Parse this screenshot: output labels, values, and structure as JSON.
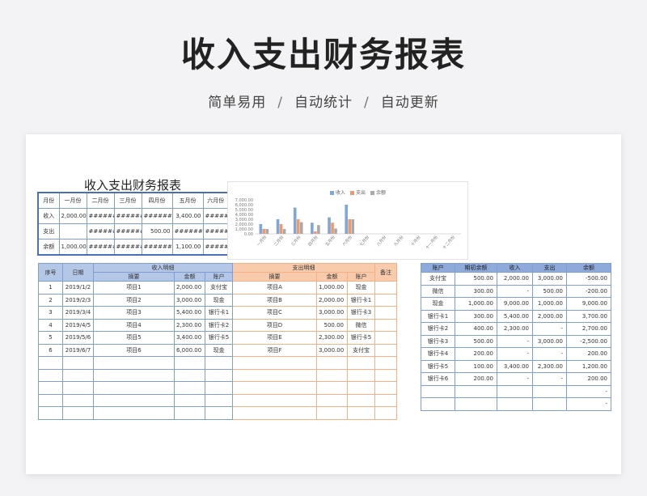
{
  "header": {
    "title": "收入支出财务报表",
    "tagline": [
      "简单易用",
      "自动统计",
      "自动更新"
    ],
    "separator": "/"
  },
  "sheet_title": "收入支出财务报表",
  "summary": {
    "months": [
      "月份",
      "一月份",
      "二月份",
      "三月份",
      "四月份",
      "五月份",
      "六月份"
    ],
    "rows": [
      {
        "label": "收入",
        "cells": [
          "2,000.00",
          "########",
          "########",
          "########",
          "3,400.00",
          "########"
        ]
      },
      {
        "label": "支出",
        "cells": [
          "",
          "########",
          "########",
          "500.00",
          "########",
          "########"
        ]
      },
      {
        "label": "余额",
        "cells": [
          "1,000.00",
          "########",
          "########",
          "########",
          "1,100.00",
          "########"
        ]
      }
    ]
  },
  "chart_data": {
    "type": "bar",
    "categories": [
      "一月份",
      "二月份",
      "三月份",
      "四月份",
      "五月份",
      "六月份",
      "七月份",
      "八月份",
      "九月份",
      "十月份",
      "十一月份",
      "十二月份"
    ],
    "series": [
      {
        "name": "收入",
        "values": [
          2000,
          3000,
          5400,
          2300,
          3400,
          6000,
          0,
          0,
          0,
          0,
          0,
          0
        ]
      },
      {
        "name": "支出",
        "values": [
          1000,
          2000,
          3000,
          500,
          2300,
          3000,
          0,
          0,
          0,
          0,
          0,
          0
        ]
      },
      {
        "name": "余额",
        "values": [
          1000,
          1000,
          2400,
          1800,
          1100,
          3000,
          0,
          0,
          0,
          0,
          0,
          0
        ]
      }
    ],
    "y_ticks": [
      "7,000.00",
      "6,000.00",
      "5,000.00",
      "4,000.00",
      "3,000.00",
      "2,000.00",
      "1,000.00",
      "0.00"
    ],
    "ylim": [
      0,
      7000
    ],
    "colors": [
      "#7ea6d8",
      "#ee9a6c",
      "#a9a9a9"
    ],
    "legend_position": "top"
  },
  "ledger": {
    "group_headers": {
      "index": "序号",
      "date": "日期",
      "income": "收入明细",
      "expense": "支出明细",
      "note": "备注"
    },
    "sub_headers": {
      "desc": "摘要",
      "amount": "金额",
      "account": "账户"
    },
    "rows": [
      {
        "no": "1",
        "date": "2019/1/2",
        "in_desc": "项目1",
        "in_amt": "2,000.00",
        "in_acct": "支付宝",
        "out_desc": "项目A",
        "out_amt": "1,000.00",
        "out_acct": "现金",
        "note": ""
      },
      {
        "no": "2",
        "date": "2019/2/3",
        "in_desc": "项目2",
        "in_amt": "3,000.00",
        "in_acct": "现金",
        "out_desc": "项目B",
        "out_amt": "2,000.00",
        "out_acct": "银行卡1",
        "note": ""
      },
      {
        "no": "3",
        "date": "2019/3/4",
        "in_desc": "项目3",
        "in_amt": "5,400.00",
        "in_acct": "银行卡1",
        "out_desc": "项目C",
        "out_amt": "3,000.00",
        "out_acct": "银行卡3",
        "note": ""
      },
      {
        "no": "4",
        "date": "2019/4/5",
        "in_desc": "项目4",
        "in_amt": "2,300.00",
        "in_acct": "银行卡2",
        "out_desc": "项目D",
        "out_amt": "500.00",
        "out_acct": "微信",
        "note": ""
      },
      {
        "no": "5",
        "date": "2019/5/6",
        "in_desc": "项目5",
        "in_amt": "3,400.00",
        "in_acct": "银行卡5",
        "out_desc": "项目E",
        "out_amt": "2,300.00",
        "out_acct": "银行卡5",
        "note": ""
      },
      {
        "no": "6",
        "date": "2019/6/7",
        "in_desc": "项目6",
        "in_amt": "6,000.00",
        "in_acct": "现金",
        "out_desc": "项目F",
        "out_amt": "3,000.00",
        "out_acct": "支付宝",
        "note": ""
      },
      {
        "no": "",
        "date": "",
        "in_desc": "",
        "in_amt": "",
        "in_acct": "",
        "out_desc": "",
        "out_amt": "",
        "out_acct": "",
        "note": ""
      },
      {
        "no": "",
        "date": "",
        "in_desc": "",
        "in_amt": "",
        "in_acct": "",
        "out_desc": "",
        "out_amt": "",
        "out_acct": "",
        "note": ""
      },
      {
        "no": "",
        "date": "",
        "in_desc": "",
        "in_amt": "",
        "in_acct": "",
        "out_desc": "",
        "out_amt": "",
        "out_acct": "",
        "note": ""
      },
      {
        "no": "",
        "date": "",
        "in_desc": "",
        "in_amt": "",
        "in_acct": "",
        "out_desc": "",
        "out_amt": "",
        "out_acct": "",
        "note": ""
      },
      {
        "no": "",
        "date": "",
        "in_desc": "",
        "in_amt": "",
        "in_acct": "",
        "out_desc": "",
        "out_amt": "",
        "out_acct": "",
        "note": ""
      }
    ]
  },
  "accounts": {
    "headers": [
      "账户",
      "期初余额",
      "收入",
      "支出",
      "余额"
    ],
    "rows": [
      [
        "支付宝",
        "500.00",
        "2,000.00",
        "3,000.00",
        "-500.00"
      ],
      [
        "微信",
        "300.00",
        "-",
        "500.00",
        "-200.00"
      ],
      [
        "现金",
        "1,000.00",
        "9,000.00",
        "1,000.00",
        "9,000.00"
      ],
      [
        "银行卡1",
        "300.00",
        "5,400.00",
        "2,000.00",
        "3,700.00"
      ],
      [
        "银行卡2",
        "400.00",
        "2,300.00",
        "-",
        "2,700.00"
      ],
      [
        "银行卡3",
        "500.00",
        "-",
        "3,000.00",
        "-2,500.00"
      ],
      [
        "银行卡4",
        "200.00",
        "-",
        "-",
        "200.00"
      ],
      [
        "银行卡5",
        "100.00",
        "3,400.00",
        "2,300.00",
        "1,200.00"
      ],
      [
        "银行卡6",
        "200.00",
        "-",
        "-",
        "200.00"
      ],
      [
        "",
        "",
        "",
        "",
        "-"
      ],
      [
        "",
        "",
        "",
        "",
        "-"
      ]
    ]
  }
}
